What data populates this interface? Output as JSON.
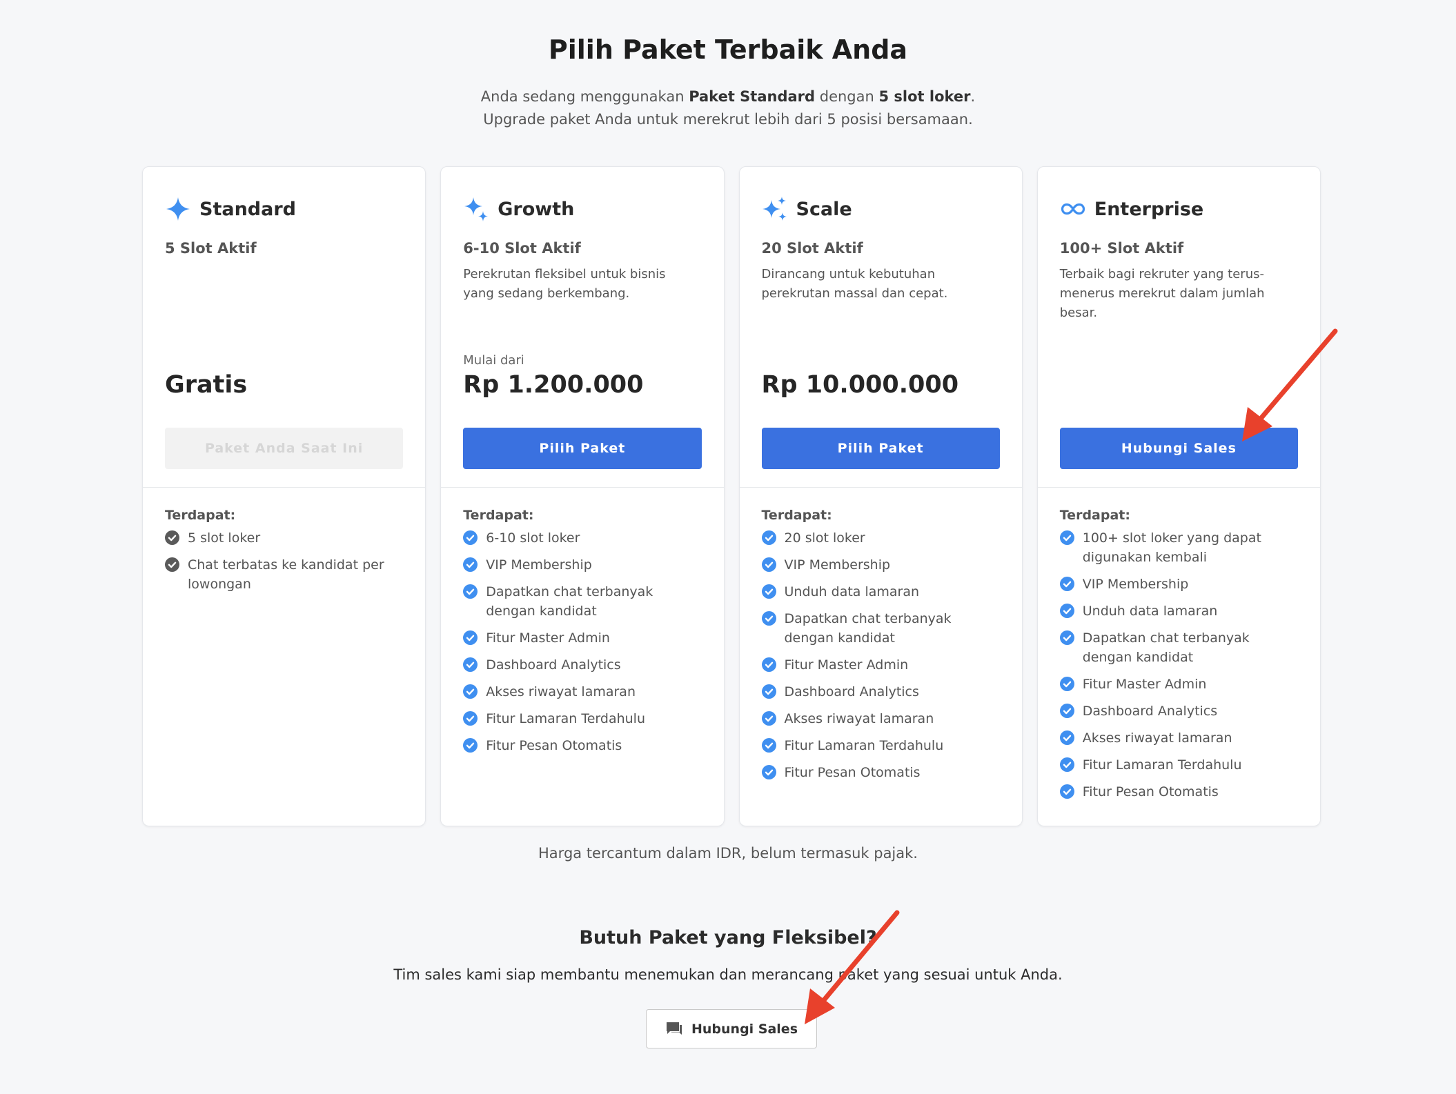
{
  "header": {
    "title": "Pilih Paket Terbaik Anda",
    "subtitle_line1_pre": "Anda sedang menggunakan ",
    "subtitle_line1_plan": "Paket Standard",
    "subtitle_line1_mid": " dengan ",
    "subtitle_line1_slots": "5 slot loker",
    "subtitle_line1_post": ".",
    "subtitle_line2": "Upgrade paket Anda untuk merekrut lebih dari 5 posisi bersamaan."
  },
  "plans": [
    {
      "name": "Standard",
      "icon": "sparkle-icon",
      "slot": "5 Slot Aktif",
      "desc": "",
      "pre_price": "",
      "price": "Gratis",
      "cta": "Paket Anda Saat Ini",
      "features_label": "Terdapat:",
      "features": [
        "5 slot loker",
        "Chat terbatas ke kandidat per lowongan"
      ]
    },
    {
      "name": "Growth",
      "icon": "sparkles-icon",
      "slot": "6-10 Slot Aktif",
      "desc": "Perekrutan fleksibel untuk bisnis yang sedang berkembang.",
      "pre_price": "Mulai dari",
      "price": "Rp 1.200.000",
      "cta": "Pilih Paket",
      "features_label": "Terdapat:",
      "features": [
        "6-10 slot loker",
        "VIP Membership",
        "Dapatkan chat terbanyak dengan kandidat",
        "Fitur Master Admin",
        "Dashboard Analytics",
        "Akses riwayat lamaran",
        "Fitur Lamaran Terdahulu",
        "Fitur Pesan Otomatis"
      ]
    },
    {
      "name": "Scale",
      "icon": "multi-sparkles-icon",
      "slot": "20 Slot Aktif",
      "desc": "Dirancang untuk kebutuhan perekrutan massal dan cepat.",
      "pre_price": "",
      "price": "Rp 10.000.000",
      "cta": "Pilih Paket",
      "features_label": "Terdapat:",
      "features": [
        "20 slot loker",
        "VIP Membership",
        "Unduh data lamaran",
        "Dapatkan chat terbanyak dengan kandidat",
        "Fitur Master Admin",
        "Dashboard Analytics",
        "Akses riwayat lamaran",
        "Fitur Lamaran Terdahulu",
        "Fitur Pesan Otomatis"
      ]
    },
    {
      "name": "Enterprise",
      "icon": "infinity-icon",
      "slot": "100+ Slot Aktif",
      "desc": "Terbaik bagi rekruter yang terus-menerus merekrut dalam jumlah besar.",
      "pre_price": "",
      "price": "",
      "cta": "Hubungi Sales",
      "features_label": "Terdapat:",
      "features": [
        "100+ slot loker yang dapat digunakan kembali",
        "VIP Membership",
        "Unduh data lamaran",
        "Dapatkan chat terbanyak dengan kandidat",
        "Fitur Master Admin",
        "Dashboard Analytics",
        "Akses riwayat lamaran",
        "Fitur Lamaran Terdahulu",
        "Fitur Pesan Otomatis"
      ]
    }
  ],
  "note": "Harga tercantum dalam IDR, belum termasuk pajak.",
  "flexible": {
    "title": "Butuh Paket yang Fleksibel?",
    "desc": "Tim sales kami siap membantu menemukan dan merancang paket yang sesuai untuk Anda.",
    "button": "Hubungi Sales",
    "button_icon": "chat-icon"
  },
  "colors": {
    "primary": "#3a71e0",
    "check_active": "#3f8ff0",
    "check_muted": "#5a5a5a",
    "arrow": "#e8412c",
    "background": "#f6f7f9"
  }
}
